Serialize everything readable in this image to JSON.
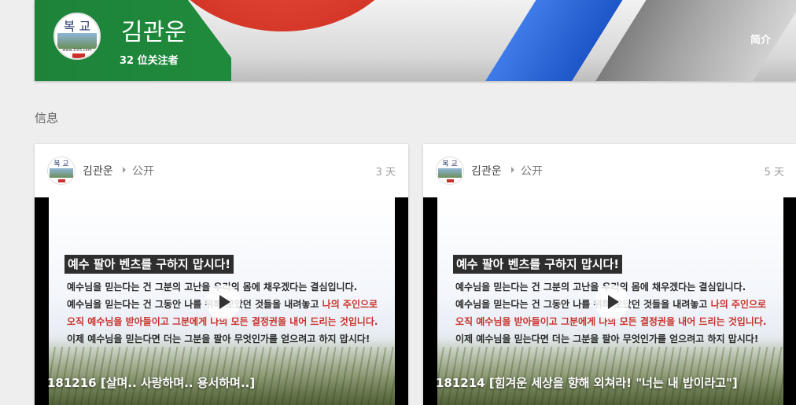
{
  "profile": {
    "name": "김관운",
    "followers": "32 位关注者",
    "intro_link": "简介",
    "avatar_logo": {
      "top_text": "복 교",
      "url": "www.1ht5.com"
    }
  },
  "section_title": "信息",
  "posts": [
    {
      "author": "김관운",
      "visibility": "公开",
      "time": "3 天",
      "slide": {
        "title": "예수 팔아 벤츠를 구하지 맙시다!",
        "line1": "예수님을 믿는다는 건 그분의 고난을 우리의 몸에 채우겠다는 결심입니다.",
        "line2_a": "예수님을 믿는다는 건 그동안 나를 위해 모았던 것들을 내려놓고 ",
        "line2_b": "나의 주인으로",
        "line3": "오직 예수님을 받아들이고 그분에게 나의 모든 결정권을 내어 드리는 것입니다.",
        "line4": "이제 예수님을 믿는다면 더는 그분을 팔아 무엇인가를 얻으려고 하지 맙시다!"
      },
      "caption": "181216 [살며.. 사랑하며.. 용서하며..]"
    },
    {
      "author": "김관운",
      "visibility": "公开",
      "time": "5 天",
      "slide": {
        "title": "예수 팔아 벤츠를 구하지 맙시다!",
        "line1": "예수님을 믿는다는 건 그분의 고난을 우리의 몸에 채우겠다는 결심입니다.",
        "line2_a": "예수님을 믿는다는 건 그동안 나를 위해 모았던 것들을 내려놓고 ",
        "line2_b": "나의 주인으로",
        "line3": "오직 예수님을 받아들이고 그분에게 나의 모든 결정권을 내어 드리는 것입니다.",
        "line4": "이제 예수님을 믿는다면 더는 그분을 팔아 무엇인가를 얻으려고 하지 맙시다!"
      },
      "caption": "181214 [힘겨운 세상을 향해 외쳐라! \"너는 내 밥이라고\"]"
    }
  ],
  "colors": {
    "cover_green": "#1f8a3c",
    "cover_red": "#e53b2c",
    "cover_blue": "#2a63d6",
    "page_bg": "#eeeeee"
  }
}
